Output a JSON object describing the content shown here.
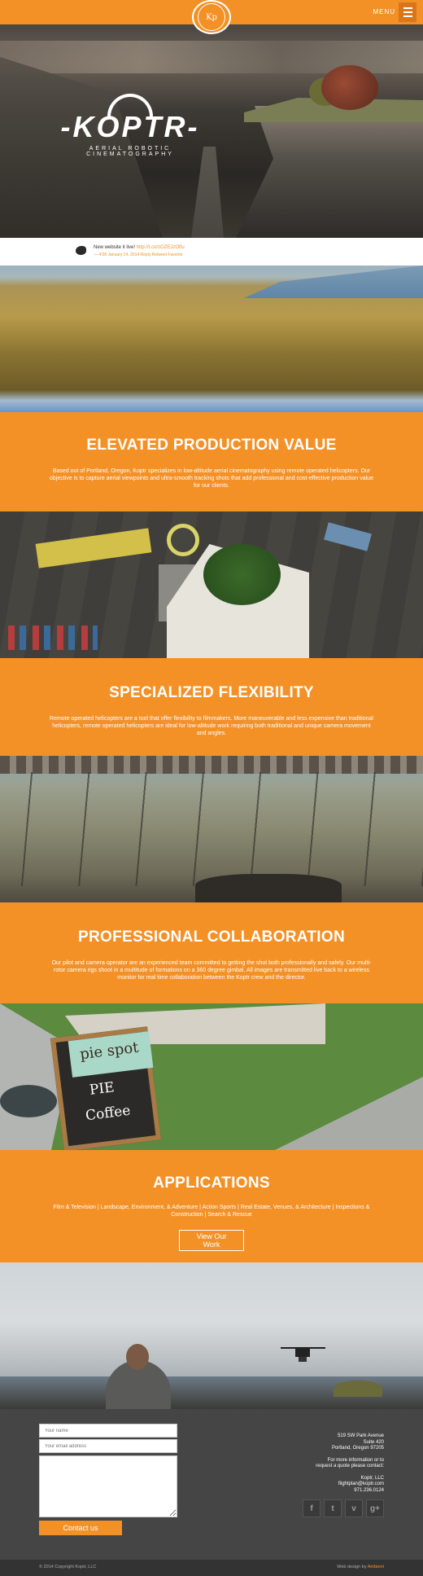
{
  "header": {
    "logo_text": "Kp",
    "menu_label": "MENU"
  },
  "hero": {
    "wordmark": "-KOPTR-",
    "tagline": "AERIAL ROBOTIC CINEMATOGRAPHY"
  },
  "tweet": {
    "text": "New website it live!",
    "link": "http://t.co/zOZEJzOfIu",
    "meta": "— 4:08 January 14, 2014 Reply Retweet Favorite"
  },
  "sections": [
    {
      "title": "ELEVATED PRODUCTION VALUE",
      "body": "Based out of Portland, Oregon, Koptr specializes in low-altitude aerial cinematography using remote operated helicopters. Our objective is to capture aerial viewpoints and ultra-smooth tracking shots that add professional and cost-effective production value for our clients."
    },
    {
      "title": "SPECIALIZED FLEXIBILITY",
      "body": "Remote operated helicopters are a tool that offer flexibility to filmmakers. More maneuverable and less expensive than traditional helicopters, remote operated helicopters are ideal for low-altitude work requiring both traditional and unique camera movement and angles."
    },
    {
      "title": "PROFESSIONAL COLLABORATION",
      "body": "Our pilot and camera operator are an experienced team committed to getting the shot both professionally and safely. Our multi-rotor camera rigs shoot in a multitude of formations on a 360 degree gimbal. All images are transmitted live back to a wireless monitor for real time collaboration between the Koptr crew and the director."
    },
    {
      "title": "APPLICATIONS",
      "body": "Film & Television | Landscape, Environment, & Adventure | Action Sports | Real Estate, Venues, & Architecture | Inspections & Construction | Search & Rescue",
      "button": "View Our Work"
    }
  ],
  "photos": {
    "sign_line1": "pie spot",
    "sign_line2": "PIE",
    "sign_line3": "Coffee"
  },
  "footer": {
    "form": {
      "name_placeholder": "Your name",
      "email_placeholder": "Your email address",
      "submit_label": "Contact us"
    },
    "address": {
      "street": "519 SW Park Avenue",
      "suite": "Suite 420",
      "city": "Portland, Oregon 97205",
      "info1": "For more information or to",
      "info2": "request a quote please contact:",
      "company": "Koptr, LLC",
      "email": "flightplan@koptr.com",
      "phone": "971.236.0124"
    },
    "social": [
      "f",
      "t",
      "v",
      "g+"
    ],
    "copyright": "© 2014 Copyright Koptr, LLC",
    "credit_prefix": "Web design by",
    "credit_name": "Ambient"
  },
  "colors": {
    "accent": "#f39127",
    "footer_bg": "#454545",
    "footbar_bg": "#333333"
  }
}
